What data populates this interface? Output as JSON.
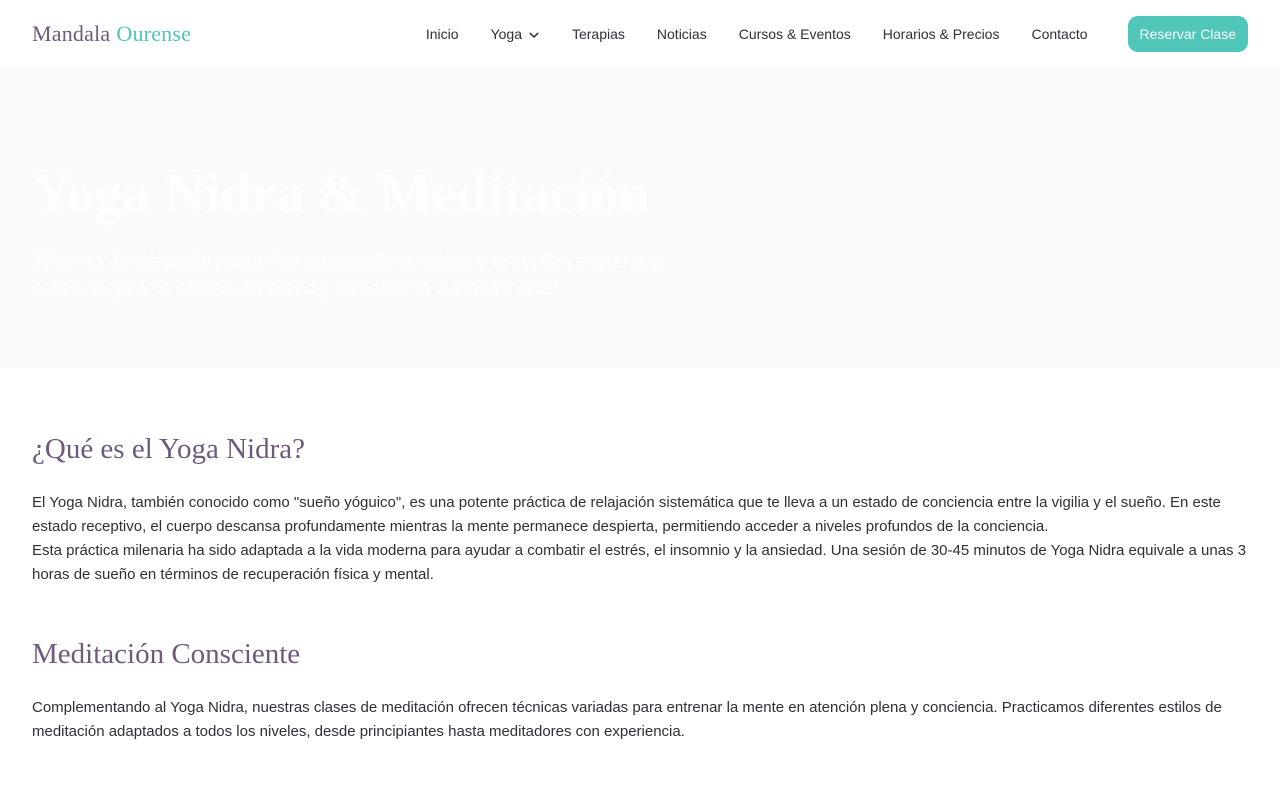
{
  "brand": {
    "part1": "Mandala",
    "part2": "Ourense"
  },
  "nav": {
    "items": [
      {
        "label": "Inicio"
      },
      {
        "label": "Yoga",
        "has_dropdown": true,
        "icon": "chevron-down-icon"
      },
      {
        "label": "Terapias"
      },
      {
        "label": "Noticias"
      },
      {
        "label": "Cursos & Eventos"
      },
      {
        "label": "Horarios & Precios"
      },
      {
        "label": "Contacto"
      }
    ],
    "cta_label": "Reservar Clase"
  },
  "hero": {
    "title": "Yoga Nidra & Meditación",
    "subtitle": "Técnicas de relajación profunda y meditación guiada que te ayudan a reducir el estrés, mejorar la calidad del sueño y aumentar la claridad mental."
  },
  "sections": [
    {
      "title": "¿Qué es el Yoga Nidra?",
      "paragraph1": "El Yoga Nidra, también conocido como \"sueño yóguico\", es una potente práctica de relajación sistemática que te lleva a un estado de conciencia entre la vigilia y el sueño. En este estado receptivo, el cuerpo descansa profundamente mientras la mente permanece despierta, permitiendo acceder a niveles profundos de la conciencia.",
      "paragraph2": "Esta práctica milenaria ha sido adaptada a la vida moderna para ayudar a combatir el estrés, el insomnio y la ansiedad. Una sesión de 30-45 minutos de Yoga Nidra equivale a unas 3 horas de sueño en términos de recuperación física y mental."
    },
    {
      "title": "Meditación Consciente",
      "paragraph1": "Complementando al Yoga Nidra, nuestras clases de meditación ofrecen técnicas variadas para entrenar la mente en atención plena y conciencia. Practicamos diferentes estilos de meditación adaptados a todos los niveles, desde principiantes hasta meditadores con experiencia."
    }
  ],
  "colors": {
    "brand_purple": "#6d5a7e",
    "brand_teal": "#4fc6b7",
    "text": "#2f2f38",
    "hero_bg": "#fafafa"
  }
}
